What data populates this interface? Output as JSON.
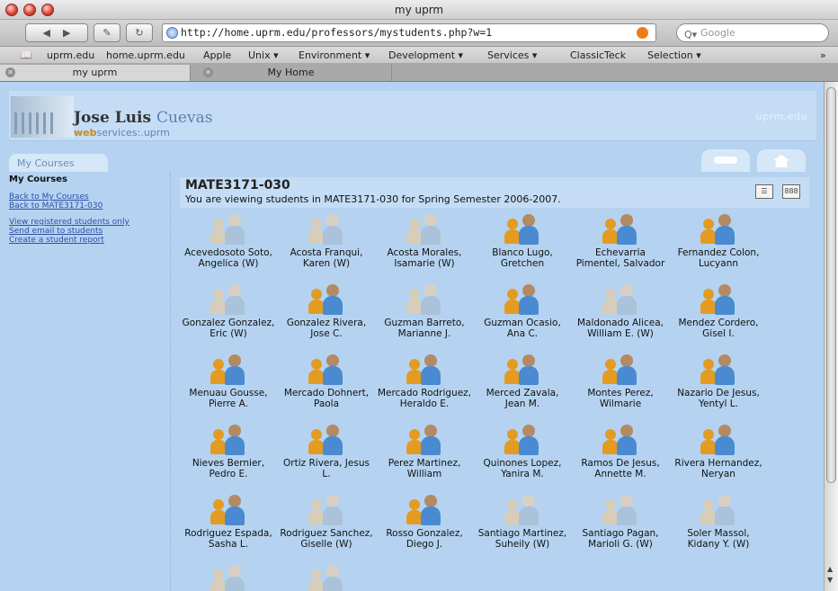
{
  "window": {
    "title": "my uprm"
  },
  "toolbar": {
    "url": "http://home.uprm.edu/professors/mystudents.php?w=1",
    "search_placeholder": "Google",
    "reload_icon": "reload-icon"
  },
  "bookmarks": [
    "uprm.edu",
    "home.uprm.edu",
    "Apple",
    "Unix ▾",
    "Environment ▾",
    "Development ▾",
    "Services ▾",
    "ClassicTeck",
    "Selection ▾"
  ],
  "tabs": [
    {
      "label": "my uprm",
      "active": true
    },
    {
      "label": "My Home",
      "active": false
    }
  ],
  "header": {
    "first_name": "Jose Luis ",
    "last_name": "Cuevas",
    "ws_bold": "web",
    "ws_rest": "services:.uprm",
    "brand": "uprm.edu"
  },
  "nav": {
    "my_courses_tab": "My Courses"
  },
  "sidebar": {
    "heading": "My Courses",
    "links_top": [
      "Back to My Courses",
      "Back to MATE3171-030"
    ],
    "links_bottom": [
      "View registered students only",
      "Send email to students",
      "Create a student report"
    ]
  },
  "course": {
    "title": "MATE3171-030",
    "subtitle": "You are viewing students in MATE3171-030 for Spring Semester 2006-2007."
  },
  "students": [
    {
      "name": "Acevedosoto Soto, Angelica (W)",
      "status": "withdrawn"
    },
    {
      "name": "Acosta Franqui, Karen (W)",
      "status": "withdrawn"
    },
    {
      "name": "Acosta Morales, Isamarie (W)",
      "status": "withdrawn"
    },
    {
      "name": "Blanco Lugo, Gretchen",
      "status": "active"
    },
    {
      "name": "Echevarria Pimentel, Salvador",
      "status": "active"
    },
    {
      "name": "Fernandez Colon, Lucyann",
      "status": "active"
    },
    {
      "name": "Gonzalez Gonzalez, Eric (W)",
      "status": "withdrawn"
    },
    {
      "name": "Gonzalez Rivera, Jose C.",
      "status": "active"
    },
    {
      "name": "Guzman Barreto, Marianne J.",
      "status": "withdrawn"
    },
    {
      "name": "Guzman Ocasio, Ana C.",
      "status": "active"
    },
    {
      "name": "Maldonado Alicea, William E. (W)",
      "status": "withdrawn"
    },
    {
      "name": "Mendez Cordero, Gisel I.",
      "status": "active"
    },
    {
      "name": "Menuau Gousse, Pierre A.",
      "status": "active"
    },
    {
      "name": "Mercado Dohnert, Paola",
      "status": "active"
    },
    {
      "name": "Mercado Rodriguez, Heraldo E.",
      "status": "active"
    },
    {
      "name": "Merced Zavala, Jean M.",
      "status": "active"
    },
    {
      "name": "Montes Perez, Wilmarie",
      "status": "active"
    },
    {
      "name": "Nazario De Jesus, Yentyl L.",
      "status": "active"
    },
    {
      "name": "Nieves Bernier, Pedro E.",
      "status": "active"
    },
    {
      "name": "Ortiz Rivera, Jesus L.",
      "status": "active"
    },
    {
      "name": "Perez Martinez, William",
      "status": "active"
    },
    {
      "name": "Quinones Lopez, Yanira M.",
      "status": "active"
    },
    {
      "name": "Ramos De Jesus, Annette M.",
      "status": "active"
    },
    {
      "name": "Rivera Hernandez, Neryan",
      "status": "active"
    },
    {
      "name": "Rodriguez Espada, Sasha L.",
      "status": "active"
    },
    {
      "name": "Rodriguez Sanchez, Giselle (W)",
      "status": "withdrawn"
    },
    {
      "name": "Rosso Gonzalez, Diego J.",
      "status": "active"
    },
    {
      "name": "Santiago Martinez, Suheily (W)",
      "status": "withdrawn"
    },
    {
      "name": "Santiago Pagan, Marioli G. (W)",
      "status": "withdrawn"
    },
    {
      "name": "Soler Massol, Kidany Y. (W)",
      "status": "withdrawn"
    },
    {
      "name": "",
      "status": "withdrawn"
    },
    {
      "name": "",
      "status": "withdrawn"
    }
  ]
}
